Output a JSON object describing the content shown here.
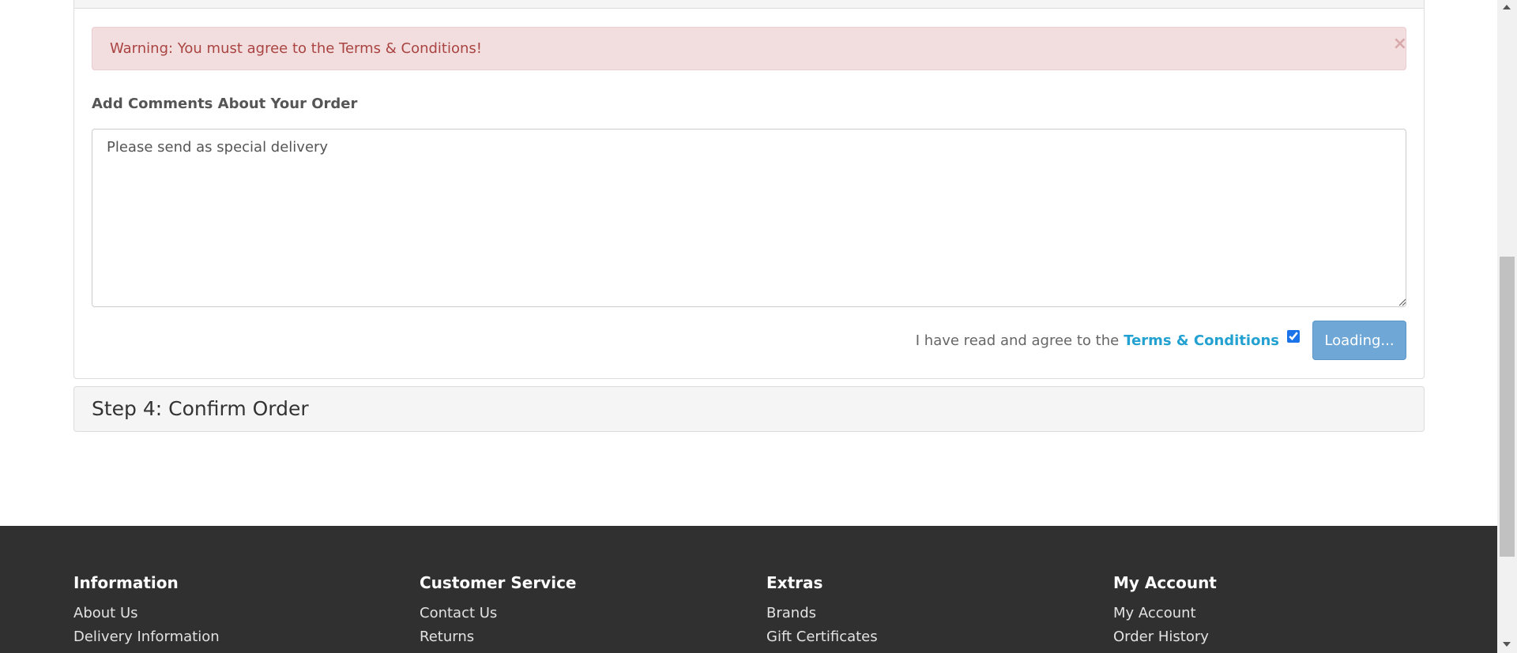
{
  "alert": {
    "message": "Warning: You must agree to the Terms & Conditions!",
    "close_glyph": "×"
  },
  "comments": {
    "label": "Add Comments About Your Order",
    "value": "Please send as special delivery"
  },
  "agree": {
    "text": "I have read and agree to the",
    "link": "Terms & Conditions",
    "checked": true,
    "button_label": "Loading..."
  },
  "step4": {
    "title": "Step 4: Confirm Order"
  },
  "footer": {
    "columns": [
      {
        "heading": "Information",
        "links": [
          "About Us",
          "Delivery Information"
        ]
      },
      {
        "heading": "Customer Service",
        "links": [
          "Contact Us",
          "Returns"
        ]
      },
      {
        "heading": "Extras",
        "links": [
          "Brands",
          "Gift Certificates"
        ]
      },
      {
        "heading": "My Account",
        "links": [
          "My Account",
          "Order History"
        ]
      }
    ]
  },
  "colors": {
    "alert_bg": "#f2dede",
    "alert_text": "#a94442",
    "link": "#23a1d1",
    "button": "#6fa7d6",
    "footer_bg": "#303030"
  }
}
